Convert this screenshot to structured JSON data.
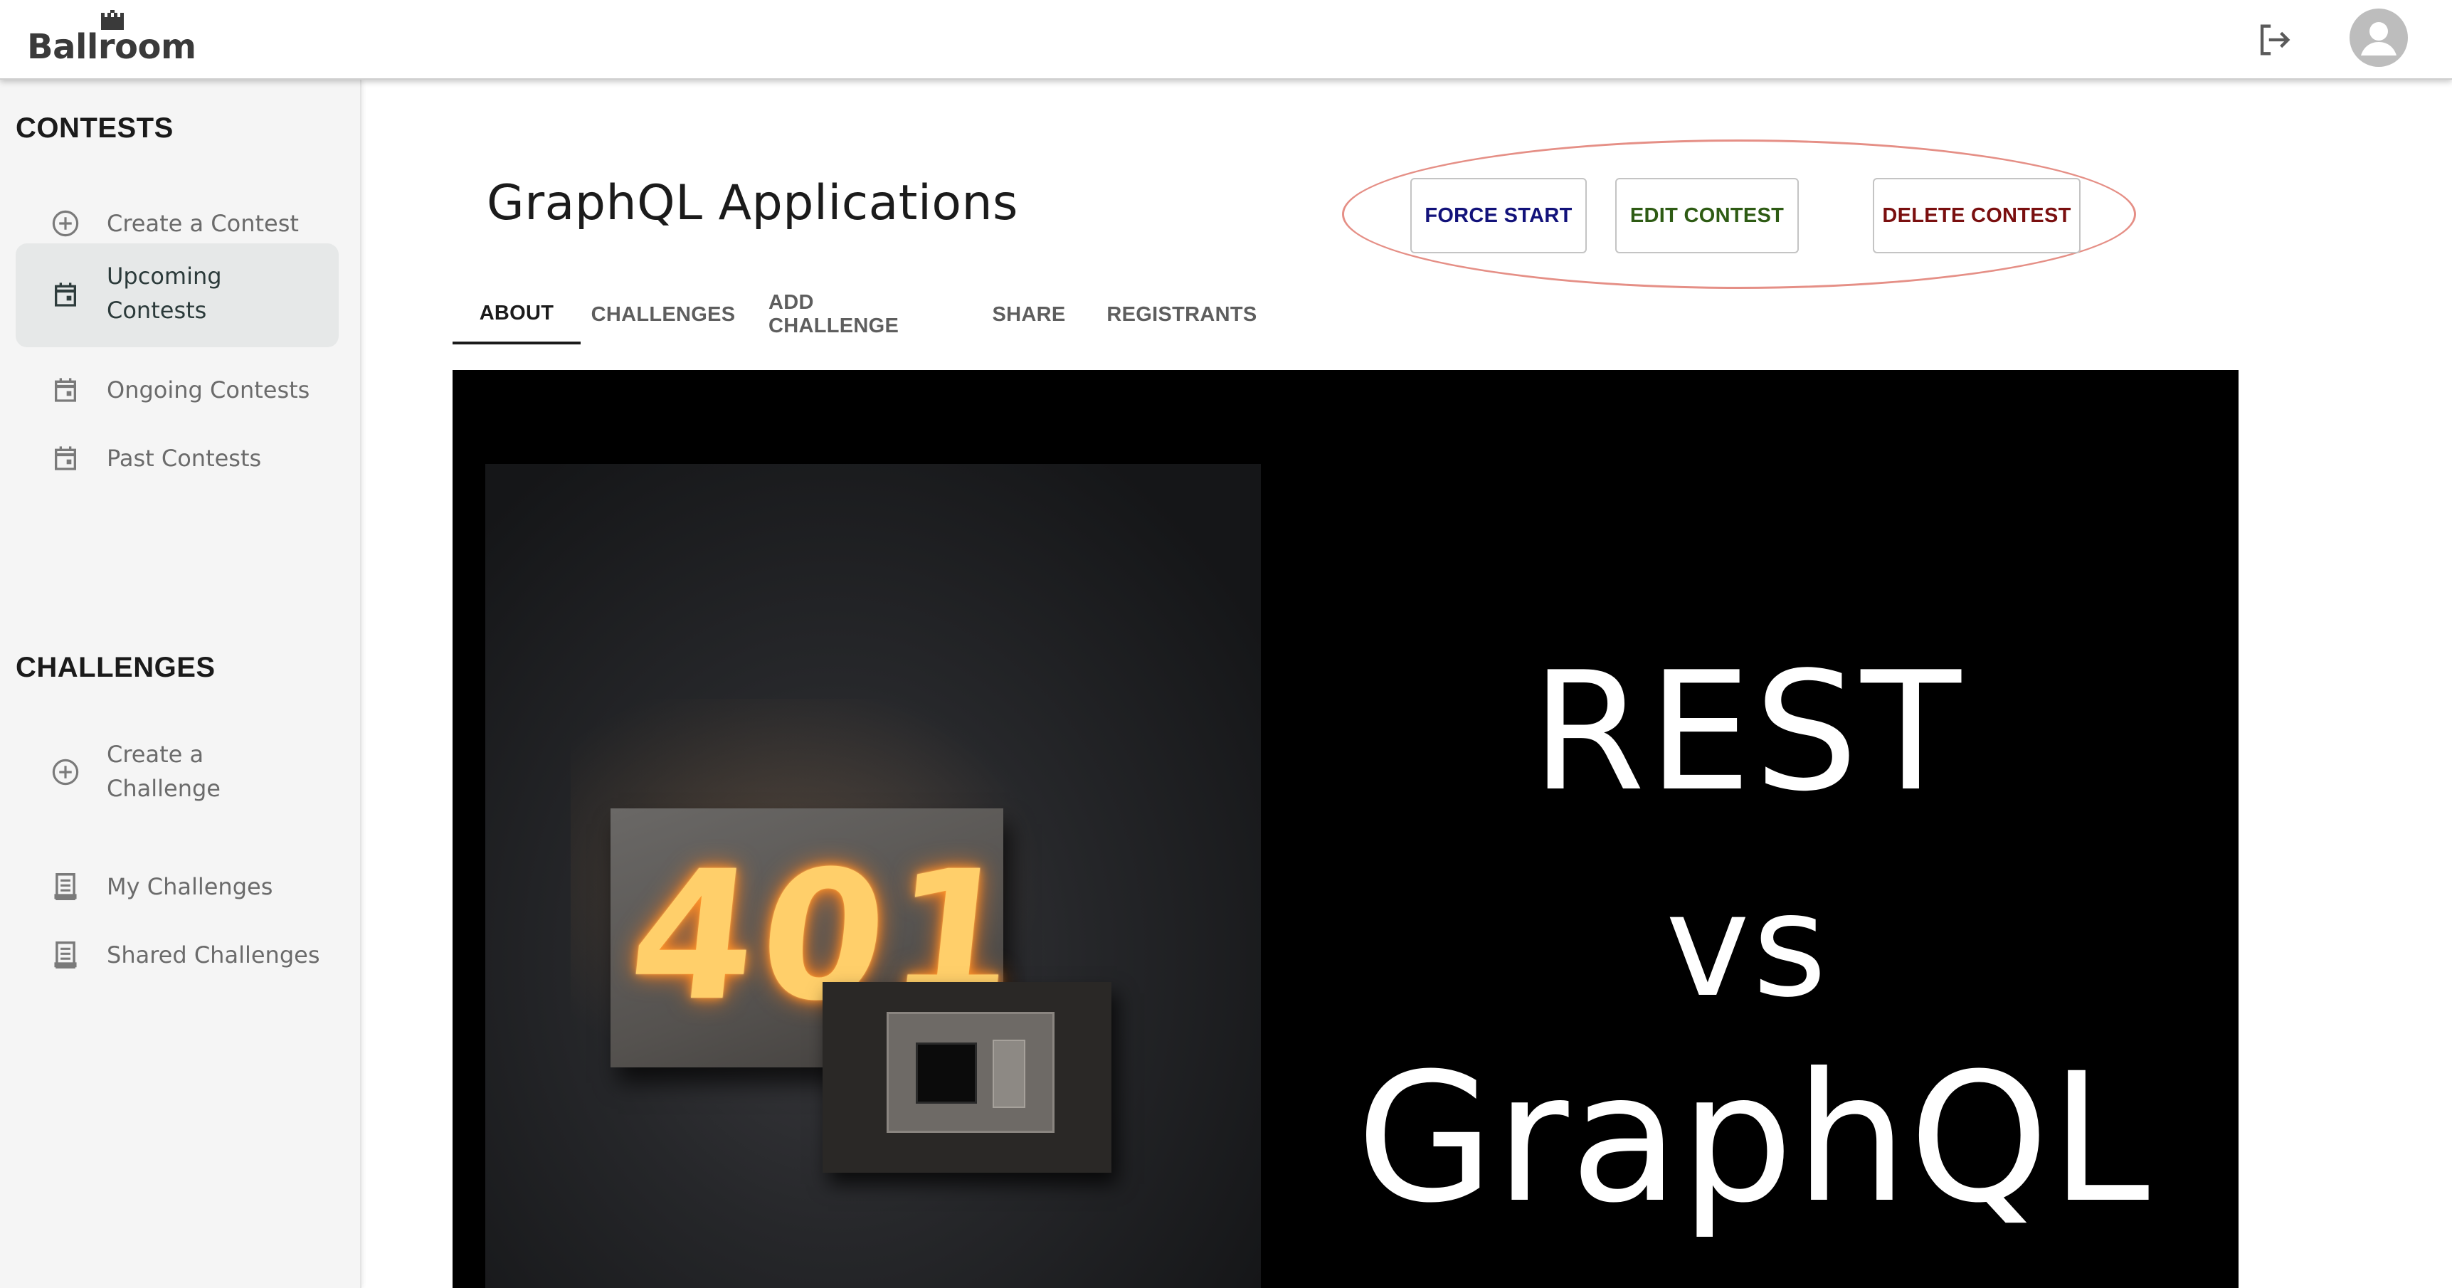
{
  "header": {
    "logo_text": "Ballroom",
    "logout_icon": "logout-icon",
    "avatar_icon": "account-icon"
  },
  "sidebar": {
    "contests_heading": "CONTESTS",
    "contests_items": [
      {
        "label": "Create a Contest",
        "icon": "add-circle-icon"
      },
      {
        "label": "Upcoming Contests",
        "icon": "calendar-icon",
        "active": true
      },
      {
        "label": "Ongoing Contests",
        "icon": "calendar-icon"
      },
      {
        "label": "Past Contests",
        "icon": "calendar-icon"
      }
    ],
    "challenges_heading": "CHALLENGES",
    "challenges_items": [
      {
        "label": "Create a Challenge",
        "icon": "add-circle-icon"
      },
      {
        "label": "My Challenges",
        "icon": "document-icon"
      },
      {
        "label": "Shared Challenges",
        "icon": "document-icon"
      }
    ]
  },
  "main": {
    "title": "GraphQL Applications",
    "actions": {
      "force_start": "FORCE START",
      "edit_contest": "EDIT CONTEST",
      "delete_contest": "DELETE CONTEST"
    },
    "colors": {
      "force_start": "#12127a",
      "edit_contest": "#2e5b14",
      "delete_contest": "#7a0f0f",
      "highlight_oval": "#e58f86"
    },
    "tabs": [
      {
        "label": "ABOUT",
        "active": true
      },
      {
        "label": "CHALLENGES"
      },
      {
        "label": "ADD CHALLENGE"
      },
      {
        "label": "SHARE"
      },
      {
        "label": "REGISTRANTS"
      }
    ],
    "banner": {
      "photo_text": "401",
      "line1": "REST",
      "line2": "vs",
      "line3": "GraphQL"
    }
  }
}
